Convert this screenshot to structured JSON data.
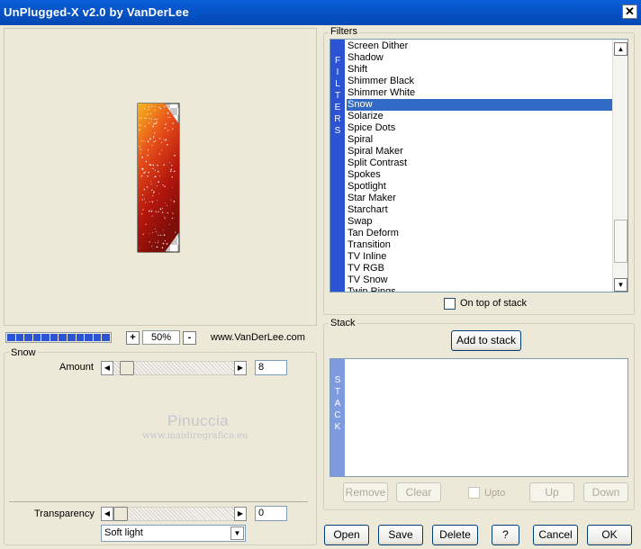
{
  "window": {
    "title": "UnPlugged-X v2.0 by VanDerLee",
    "close_glyph": "✕"
  },
  "zoom": {
    "minus": "-",
    "plus": "+",
    "value": "50%"
  },
  "progress": {
    "segments": 12,
    "fraction": 1.0
  },
  "website": "www.VanDerLee.com",
  "filter_params": {
    "group_label": "Snow",
    "amount_label": "Amount",
    "amount_value": "8",
    "amount_slider_fraction": 0.06,
    "watermark_title": "Pinuccia",
    "watermark_url": "www.maidiregrafica.eu",
    "transparency_label": "Transparency",
    "transparency_value": "0",
    "transparency_slider_fraction": 0.0,
    "blend_mode": "Soft light"
  },
  "filters": {
    "group_label": "Filters",
    "vertical_label": [
      "F",
      "I",
      "L",
      "T",
      "E",
      "R",
      "S"
    ],
    "items": [
      "Screen Dither",
      "Shadow",
      "Shift",
      "Shimmer Black",
      "Shimmer White",
      "Snow",
      "Solarize",
      "Spice Dots",
      "Spiral",
      "Spiral Maker",
      "Split Contrast",
      "Spokes",
      "Spotlight",
      "Star Maker",
      "Starchart",
      "Swap",
      "Tan Deform",
      "Transition",
      "TV Inline",
      "TV RGB",
      "TV Snow",
      "Twin Rings"
    ],
    "selected": "Snow",
    "on_top_label": "On top of stack"
  },
  "stack": {
    "group_label": "Stack",
    "add_label": "Add to stack",
    "vertical_label": [
      "S",
      "T",
      "A",
      "C",
      "K"
    ],
    "remove_label": "Remove",
    "clear_label": "Clear",
    "upto_label": "Upto",
    "up_label": "Up",
    "down_label": "Down"
  },
  "footer": {
    "open_label": "Open",
    "save_label": "Save",
    "delete_label": "Delete",
    "help_label": "?",
    "cancel_label": "Cancel",
    "ok_label": "OK"
  },
  "colors": {
    "titlebar": "#0a5fd8",
    "selection": "#316ac5",
    "filters_strip": "#2b53d4",
    "stack_strip": "#7f9be0"
  }
}
